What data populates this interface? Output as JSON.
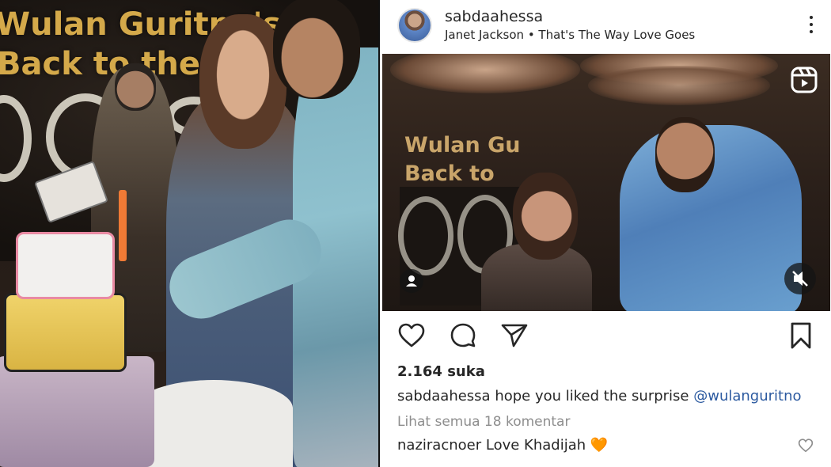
{
  "photo": {
    "banner_line_1": "Wulan Guritno's",
    "banner_line_2": "Back to the 90"
  },
  "post": {
    "username": "sabdaahessa",
    "audio": "Janet Jackson • That's The Way Love Goes",
    "media_sign_line_1": "Wulan Gu",
    "media_sign_line_2": "Back to",
    "likes": "2.164 suka",
    "caption": {
      "username": "sabdaahessa",
      "text": "hope you liked the surprise",
      "mention": "@wulanguritno"
    },
    "view_comments": "Lihat semua 18 komentar",
    "comment": {
      "username": "naziracnoer",
      "text": "Love Khadijah 🧡"
    },
    "icons": {
      "more": "more-options-icon",
      "reels": "reels-icon",
      "tag": "user-tag-icon",
      "mute": "mute-icon",
      "like": "heart-icon",
      "comment": "comment-icon",
      "share": "send-icon",
      "save": "bookmark-icon"
    }
  },
  "colors": {
    "mention": "#2c5aa0",
    "muted": "#8e8e8e",
    "text": "#262626",
    "banner": "#d4a94a"
  }
}
